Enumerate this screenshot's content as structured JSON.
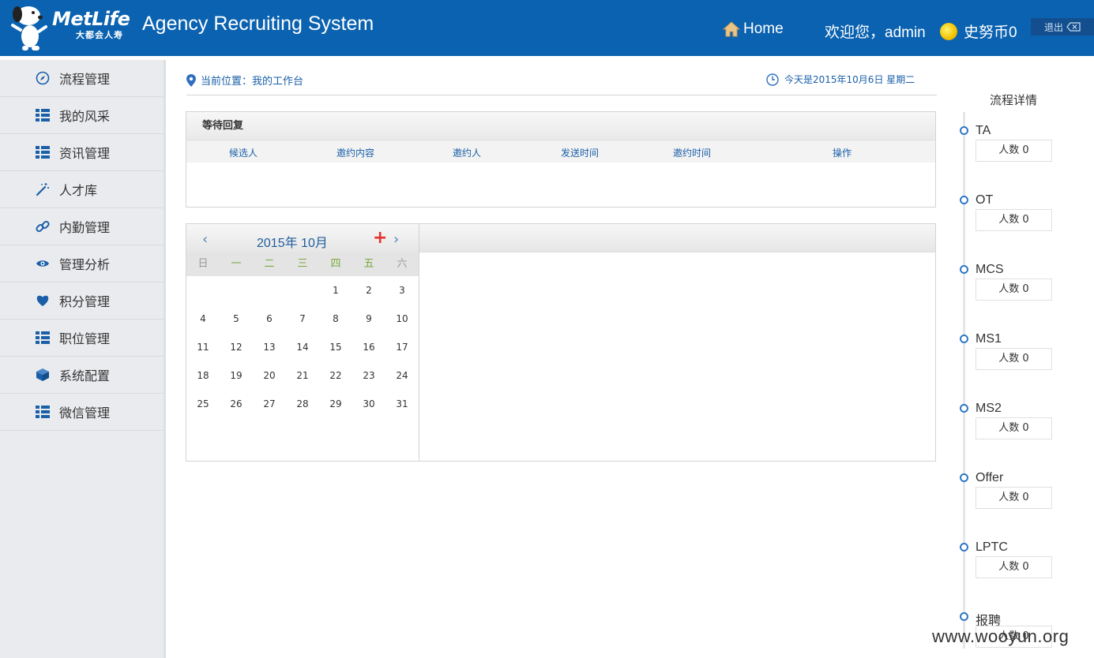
{
  "header": {
    "brand_name": "MetLife",
    "brand_sub": "大都会人寿",
    "system_title": "Agency Recruiting System",
    "home_label": "Home",
    "welcome_text": "欢迎您，admin",
    "coin_text": "史努币0",
    "logout_label": "退出",
    "bg_color": "#0a62b0"
  },
  "sidebar": {
    "items": [
      {
        "label": "流程管理",
        "icon": "compass-icon"
      },
      {
        "label": "我的风采",
        "icon": "grid-list-icon"
      },
      {
        "label": "资讯管理",
        "icon": "grid-list-icon"
      },
      {
        "label": "人才库",
        "icon": "magic-wand-icon"
      },
      {
        "label": "内勤管理",
        "icon": "link-icon"
      },
      {
        "label": "管理分析",
        "icon": "eye-icon"
      },
      {
        "label": "积分管理",
        "icon": "heart-icon"
      },
      {
        "label": "职位管理",
        "icon": "grid-list-icon"
      },
      {
        "label": "系统配置",
        "icon": "cube-icon"
      },
      {
        "label": "微信管理",
        "icon": "grid-list-icon"
      }
    ]
  },
  "breadcrumb": {
    "text": "当前位置：我的工作台"
  },
  "today": {
    "text": "今天是2015年10月6日 星期二"
  },
  "waiting": {
    "title": "等待回复",
    "columns": [
      "候选人",
      "邀约内容",
      "邀约人",
      "发送时间",
      "邀约时间",
      "操作"
    ]
  },
  "calendar": {
    "title": "2015年 10月",
    "weekdays": [
      "日",
      "一",
      "二",
      "三",
      "四",
      "五",
      "六"
    ],
    "days": [
      "",
      "",
      "",
      "",
      "1",
      "2",
      "3",
      "4",
      "5",
      "6",
      "7",
      "8",
      "9",
      "10",
      "11",
      "12",
      "13",
      "14",
      "15",
      "16",
      "17",
      "18",
      "19",
      "20",
      "21",
      "22",
      "23",
      "24",
      "25",
      "26",
      "27",
      "28",
      "29",
      "30",
      "31"
    ],
    "weekday_colors": [
      "#999999",
      "#7aa93c",
      "#7aa93c",
      "#7aa93c",
      "#7aa93c",
      "#7aa93c",
      "#999999"
    ]
  },
  "flow": {
    "title": "流程详情",
    "stages": [
      {
        "name": "TA",
        "count": "人数 0"
      },
      {
        "name": "OT",
        "count": "人数 0"
      },
      {
        "name": "MCS",
        "count": "人数 0"
      },
      {
        "name": "MS1",
        "count": "人数 0"
      },
      {
        "name": "MS2",
        "count": "人数 0"
      },
      {
        "name": "Offer",
        "count": "人数 0"
      },
      {
        "name": "LPTC",
        "count": "人数 0"
      },
      {
        "name": "报聘",
        "count": "人数 0"
      }
    ]
  },
  "watermark": "www.wooyun.org"
}
